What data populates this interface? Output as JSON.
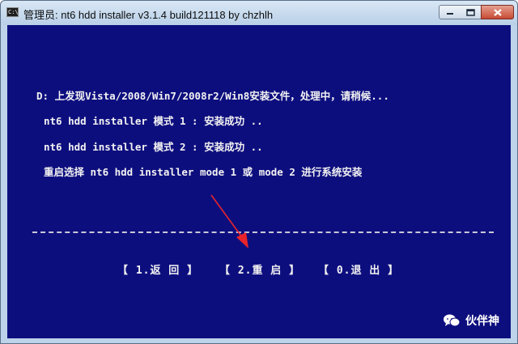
{
  "window": {
    "title": "管理员: nt6 hdd installer v3.1.4 build121118 by chzhlh",
    "icon_text": "C:\\"
  },
  "console": {
    "lines": [
      "D: 上发现Vista/2008/Win7/2008r2/Win8安装文件，处理中，请稍候...",
      "nt6 hdd installer 模式 1 : 安装成功 ..",
      "nt6 hdd installer 模式 2 : 安装成功 ..",
      "重启选择 nt6 hdd installer mode 1 或 mode 2 进行系统安装"
    ],
    "separator": "---------------------------------------------------------------------------------"
  },
  "menu": {
    "back": "【 1.返 回 】",
    "restart": "【 2.重 启 】",
    "exit": "【 0.退 出 】"
  },
  "watermark": {
    "text": "伙伴神"
  },
  "colors": {
    "console_bg": "#0d0e7e",
    "console_text": "#f2f2f2",
    "arrow": "#e8242b"
  }
}
